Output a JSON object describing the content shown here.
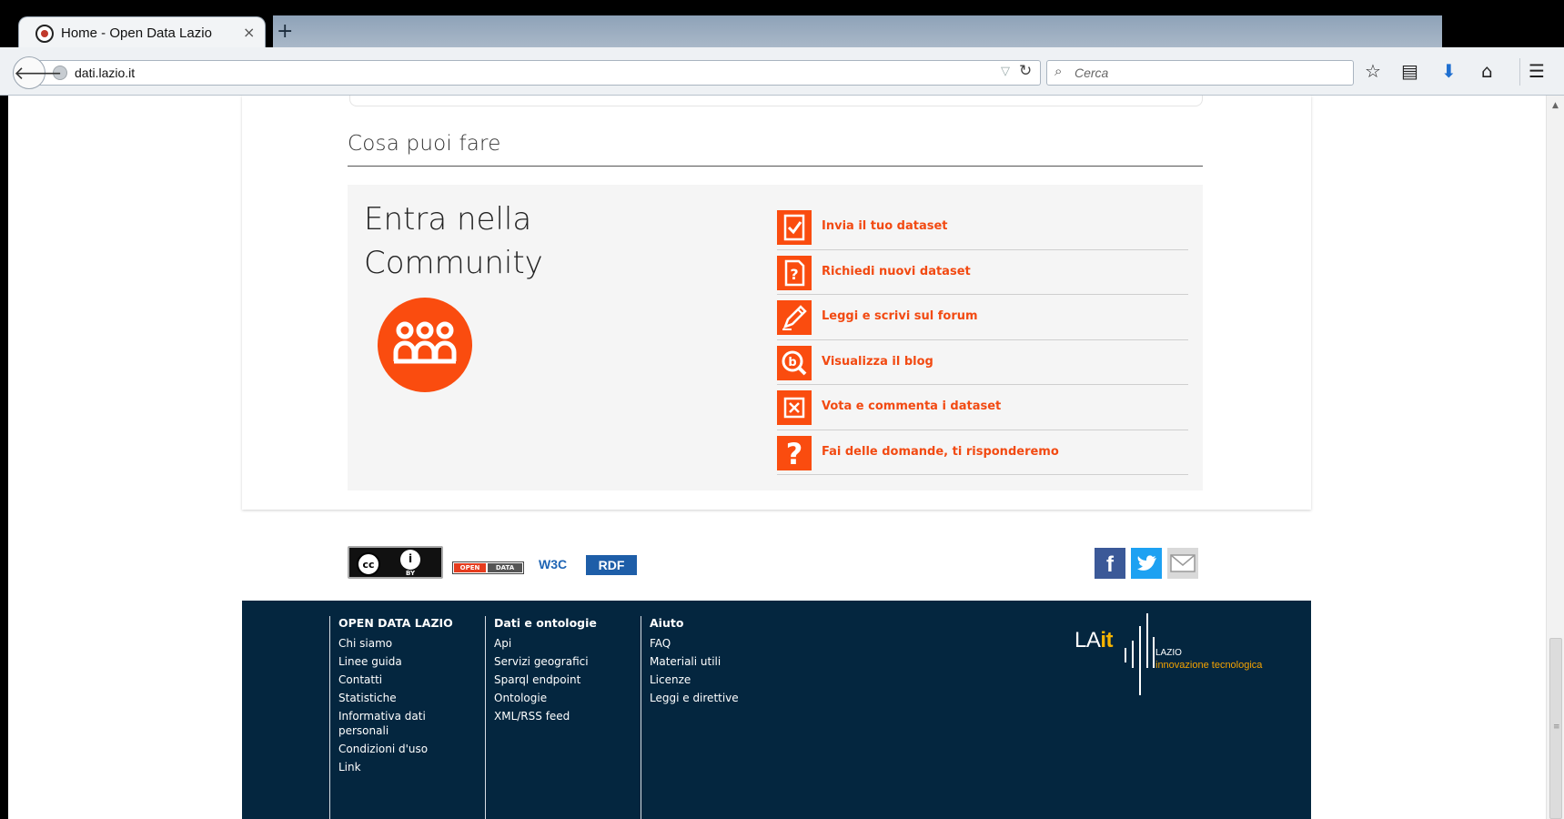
{
  "browser": {
    "tab_title": "Home - Open Data Lazio",
    "tab_close": "×",
    "new_tab": "+",
    "url": "dati.lazio.it",
    "search_placeholder": "Cerca"
  },
  "section": {
    "title": "Cosa puoi fare"
  },
  "community": {
    "title_line1": "Entra nella",
    "title_line2": "Community",
    "accent_color": "#fa4c0f",
    "actions": [
      {
        "label": "Invia il tuo dataset",
        "icon": "checklist-icon"
      },
      {
        "label": "Richiedi nuovi dataset",
        "icon": "question-document-icon"
      },
      {
        "label": "Leggi e scrivi sul forum",
        "icon": "pencil-icon"
      },
      {
        "label": "Visualizza il blog",
        "icon": "blog-search-icon"
      },
      {
        "label": "Vota e commenta i dataset",
        "icon": "vote-box-icon"
      },
      {
        "label": "Fai delle domande, ti risponderemo",
        "icon": "question-mark-icon"
      }
    ]
  },
  "badges": {
    "cc": "cc",
    "by": "BY",
    "opendata_left": "OPEN",
    "opendata_right": "DATA",
    "w3c": "W3C",
    "rdf": "RDF"
  },
  "social": {
    "facebook": "f"
  },
  "footer": {
    "columns": [
      {
        "heading": "OPEN DATA LAZIO",
        "items": [
          "Chi siamo",
          "Linee guida",
          "Contatti",
          "Statistiche",
          "Informativa dati personali",
          "Condizioni d'uso",
          "Link"
        ]
      },
      {
        "heading": "Dati e ontologie",
        "items": [
          "Api",
          "Servizi geografici",
          "Sparql endpoint",
          "Ontologie",
          "XML/RSS feed"
        ]
      },
      {
        "heading": "Aiuto",
        "items": [
          "FAQ",
          "Materiali utili",
          "Licenze",
          "Leggi e direttive"
        ]
      }
    ],
    "logo": {
      "la": "LA",
      "it": "it",
      "lazio": "LAZIO",
      "subtitle": "innovazione tecnologica"
    },
    "background": "#04263f"
  }
}
